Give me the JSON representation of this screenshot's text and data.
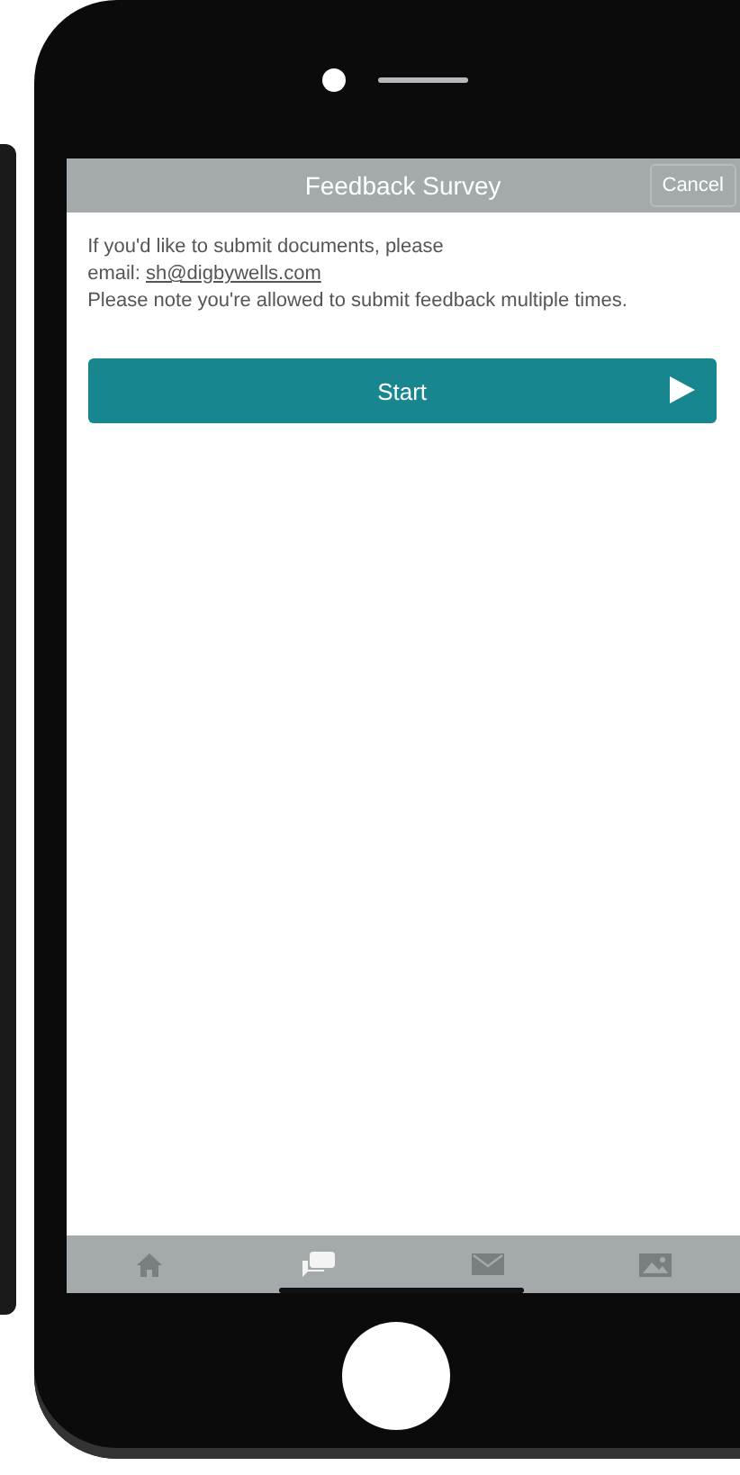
{
  "header": {
    "title": "Feedback Survey",
    "cancel": "Cancel"
  },
  "message": {
    "line_1": "If you'd like to submit documents, please",
    "email_label": "email:",
    "email": "sh@digbywells.com",
    "line_2": "Please note you're allowed to submit feedback multiple times."
  },
  "start_button": {
    "label": "Start"
  },
  "tab_bar": [
    {
      "kind": "home",
      "selected": false
    },
    {
      "kind": "chat",
      "selected": true
    },
    {
      "kind": "mail",
      "selected": false
    },
    {
      "kind": "image",
      "selected": false
    }
  ]
}
